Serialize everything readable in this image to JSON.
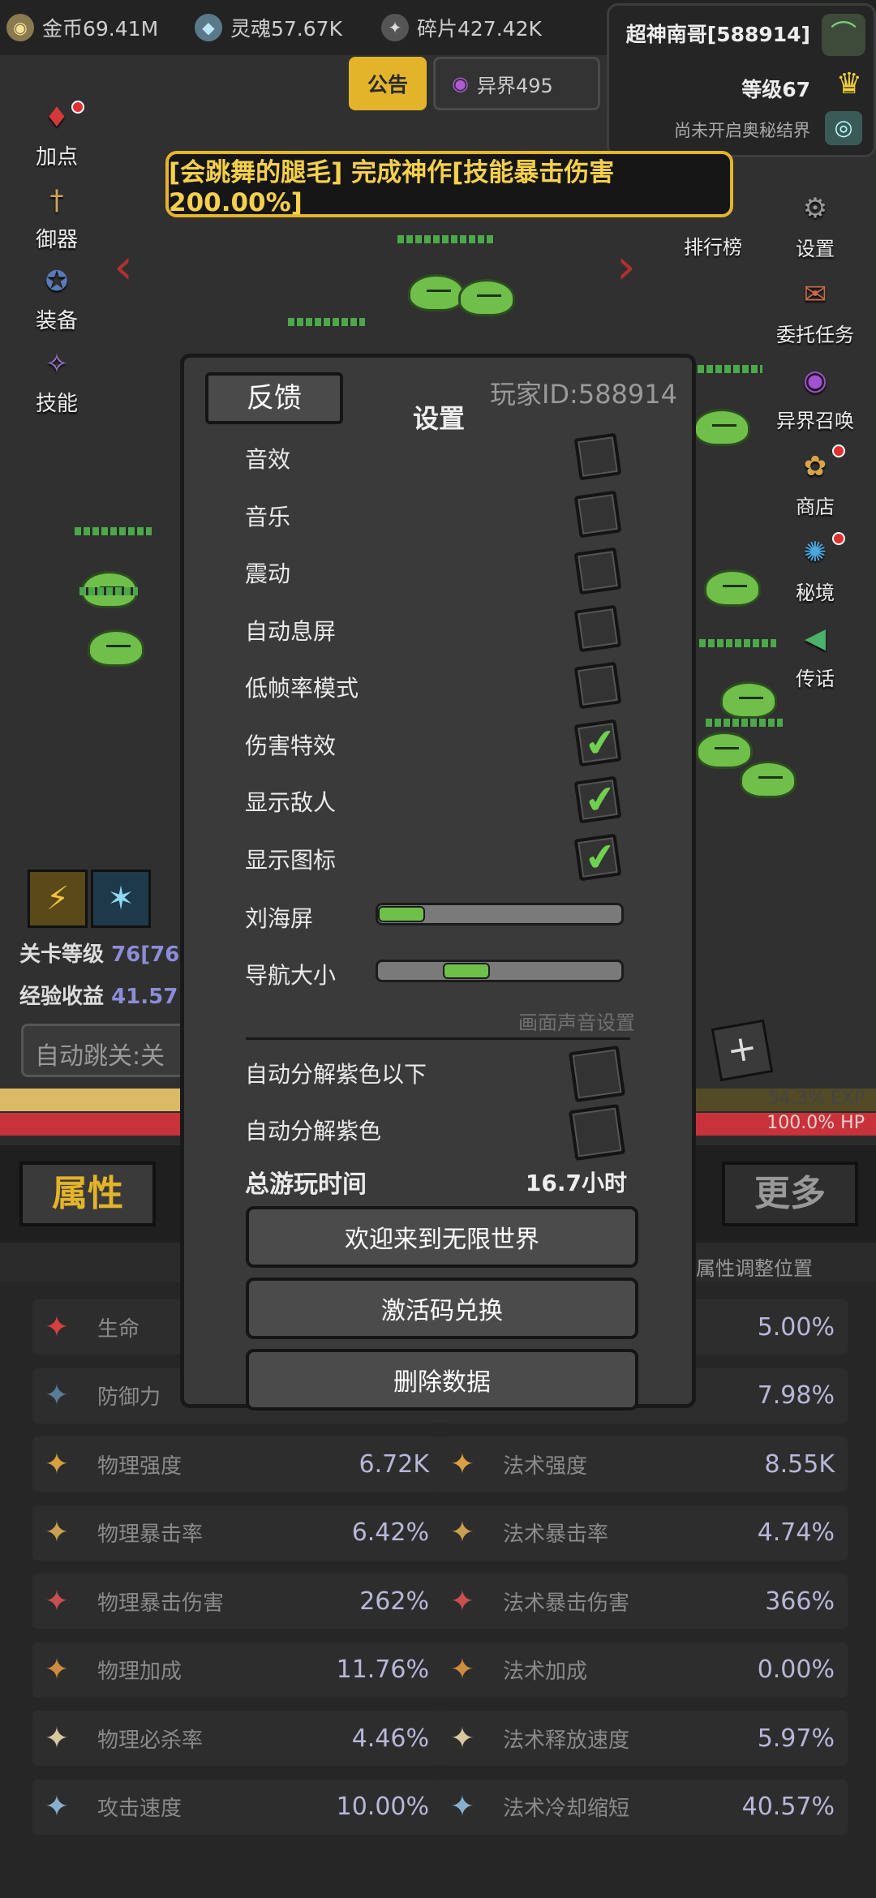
{
  "currency": {
    "gold": "金币69.41M",
    "soul": "灵魂57.67K",
    "shard": "碎片427.42K"
  },
  "top_tabs": {
    "notice": "公告",
    "otherworld": "异界495"
  },
  "player": {
    "name": "超神南哥[588914]",
    "level": "等级67",
    "realm_status": "尚未开启奥秘结界"
  },
  "banner_text": "[会跳舞的腿毛] 完成神作[技能暴击伤害 200.00%]",
  "left_menu": [
    "加点",
    "御器",
    "装备",
    "技能"
  ],
  "right_menu": [
    "排行榜",
    "设置",
    "委托任务",
    "异界召唤",
    "商店",
    "秘境",
    "传话"
  ],
  "hud": {
    "stage_level_label": "关卡等级",
    "stage_level_value": "76[76",
    "exp_income_label": "经验收益",
    "exp_income_value": "41.57",
    "auto_skip": "自动跳关:关",
    "exp_text": "54.3% EXP",
    "hp_text": "100.0% HP",
    "exp_percent": 54.3,
    "hp_percent": 100.0
  },
  "tabs": {
    "attributes": "属性",
    "more": "更多",
    "adjust_position": "属性调整位置"
  },
  "settings": {
    "feedback": "反馈",
    "title": "设置",
    "player_id": "玩家ID:588914",
    "toggles": [
      {
        "label": "音效",
        "checked": false
      },
      {
        "label": "音乐",
        "checked": false
      },
      {
        "label": "震动",
        "checked": false
      },
      {
        "label": "自动息屏",
        "checked": false
      },
      {
        "label": "低帧率模式",
        "checked": false
      },
      {
        "label": "伤害特效",
        "checked": true
      },
      {
        "label": "显示敌人",
        "checked": true
      },
      {
        "label": "显示图标",
        "checked": true
      }
    ],
    "notch_label": "刘海屏",
    "notch_level": 0.0,
    "nav_label": "导航大小",
    "nav_level": 0.33,
    "av_settings": "画面声音设置",
    "auto_decompose_below_purple": "自动分解紫色以下",
    "auto_decompose_purple": "自动分解紫色",
    "total_time_label": "总游玩时间",
    "total_time_value": "16.7小时",
    "welcome": "欢迎来到无限世界",
    "redeem": "激活码兑换",
    "delete": "删除数据"
  },
  "stats": {
    "left": [
      {
        "icon": "heart-icon",
        "label": "生命",
        "value": ""
      },
      {
        "icon": "shield-icon",
        "label": "防御力",
        "value": ""
      },
      {
        "icon": "sword-icon",
        "label": "物理强度",
        "value": "6.72K"
      },
      {
        "icon": "axe-icon",
        "label": "物理暴击率",
        "value": "6.42%"
      },
      {
        "icon": "blade-icon",
        "label": "物理暴击伤害",
        "value": "262%"
      },
      {
        "icon": "arrow-icon",
        "label": "物理加成",
        "value": "11.76%"
      },
      {
        "icon": "skull-icon",
        "label": "物理必杀率",
        "value": "4.46%"
      },
      {
        "icon": "speed-sword-icon",
        "label": "攻击速度",
        "value": "10.00%"
      }
    ],
    "right": [
      {
        "icon": "",
        "label": "",
        "value": "5.00%"
      },
      {
        "icon": "",
        "label": "",
        "value": "7.98%"
      },
      {
        "icon": "magic-icon",
        "label": "法术强度",
        "value": "8.55K"
      },
      {
        "icon": "magic-crit-icon",
        "label": "法术暴击率",
        "value": "4.74%"
      },
      {
        "icon": "magic-burst-icon",
        "label": "法术暴击伤害",
        "value": "366%"
      },
      {
        "icon": "magic-plus-icon",
        "label": "法术加成",
        "value": "0.00%"
      },
      {
        "icon": "wave-icon",
        "label": "法术释放速度",
        "value": "5.97%"
      },
      {
        "icon": "hourglass-icon",
        "label": "法术冷却缩短",
        "value": "40.57%"
      }
    ]
  }
}
